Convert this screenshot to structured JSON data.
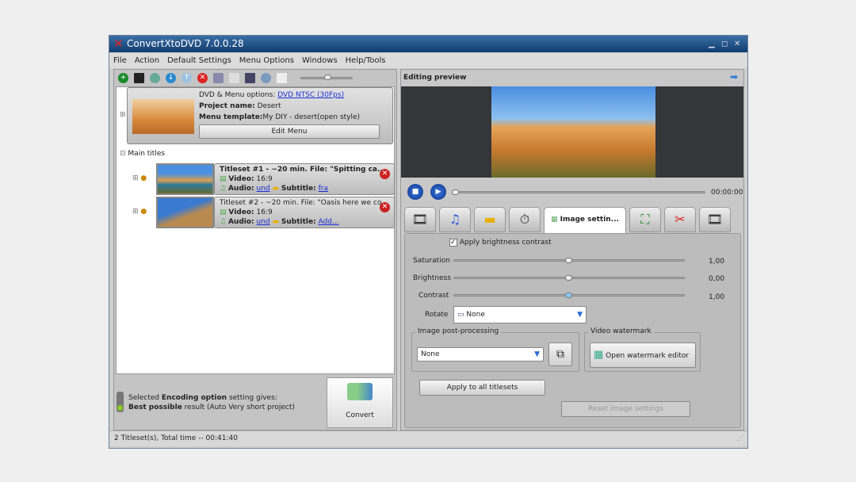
{
  "window": {
    "title": "ConvertXtoDVD 7.0.0.28"
  },
  "menu": [
    "File",
    "Action",
    "Default Settings",
    "Menu Options",
    "Windows",
    "Help/Tools"
  ],
  "project": {
    "dvd_label": "DVD & Menu options:",
    "dvd_value": "DVD NTSC (30Fps)",
    "name_label": "Project name:",
    "name_value": "Desert",
    "template_label": "Menu template:",
    "template_value": "My  DIY - desert(open style)",
    "edit_menu": "Edit Menu"
  },
  "tree": {
    "main_titles": "Main titles"
  },
  "titlesets": [
    {
      "title": "Titleset #1 - ~20 min. File: \"Spitting ca...",
      "video_label": "Video:",
      "video": "16:9",
      "audio_label": "Audio:",
      "audio": "und",
      "subtitle_label": "Subtitle:",
      "subtitle": "fra"
    },
    {
      "title": "Titleset #2 - ~20 min. File: \"Oasis here we co...",
      "video_label": "Video:",
      "video": "16:9",
      "audio_label": "Audio:",
      "audio": "und",
      "subtitle_label": "Subtitle:",
      "subtitle": "Add..."
    }
  ],
  "encoding": {
    "l1a": "Selected ",
    "l1b": "Encoding option",
    "l1c": " setting gives:",
    "l2a": "Best possible",
    "l2b": " result (Auto Very short project)"
  },
  "convert": "Convert",
  "status": "2 Titleset(s), Total time -- 00:41:40",
  "preview": {
    "title": "Editing preview",
    "time": "00:00:00"
  },
  "tabs": {
    "active": "Image settin..."
  },
  "image_settings": {
    "apply": "Apply brightness contrast",
    "apply_checked": true,
    "sliders": [
      {
        "label": "Saturation",
        "value": "1,00",
        "pos": 0.5
      },
      {
        "label": "Brightness",
        "value": "0,00",
        "pos": 0.5
      },
      {
        "label": "Contrast",
        "value": "1,00",
        "pos": 0.5
      }
    ],
    "rotate_label": "Rotate",
    "rotate": "None",
    "post_label": "Image post-processing",
    "post": "None",
    "watermark_label": "Video watermark",
    "watermark_btn": "Open watermark editor",
    "apply_all": "Apply to all titlesets",
    "reset": "Reset image settings"
  }
}
